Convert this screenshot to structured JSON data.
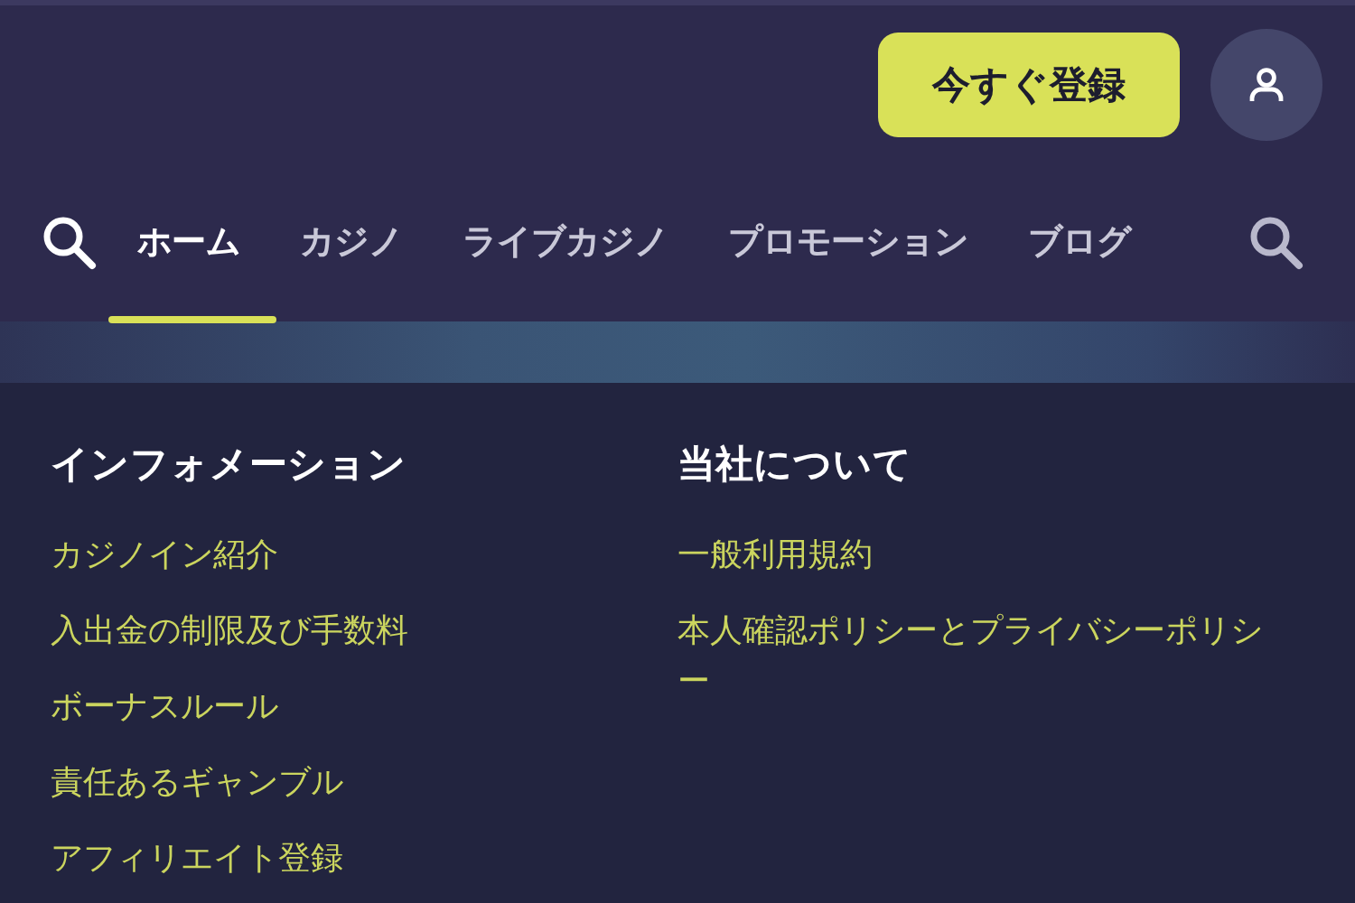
{
  "header": {
    "register_button": "今すぐ登録"
  },
  "nav": {
    "tabs": [
      {
        "label": "ホーム",
        "selected": true
      },
      {
        "label": "カジノ",
        "selected": false
      },
      {
        "label": "ライブカジノ",
        "selected": false
      },
      {
        "label": "プロモーション",
        "selected": false
      },
      {
        "label": "ブログ",
        "selected": false
      }
    ]
  },
  "footer": {
    "columns": [
      {
        "heading": "インフォメーション",
        "links": [
          "カジノイン紹介",
          "入出金の制限及び手数料",
          "ボーナスルール",
          "責任あるギャンブル",
          "アフィリエイト登録"
        ]
      },
      {
        "heading": "当社について",
        "links": [
          "一般利用規約",
          "本人確認ポリシーとプライバシーポリシー"
        ]
      }
    ]
  }
}
